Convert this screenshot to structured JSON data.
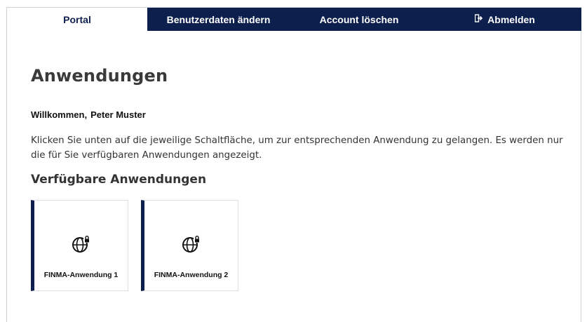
{
  "tabs": [
    {
      "label": "Portal",
      "active": true
    },
    {
      "label": "Benutzerdaten ändern",
      "active": false
    },
    {
      "label": "Account löschen",
      "active": false
    },
    {
      "label": "Abmelden",
      "active": false,
      "icon": "logout-icon"
    }
  ],
  "page": {
    "title": "Anwendungen",
    "welcome_label": "Willkommen,",
    "user_name": "Peter Muster",
    "intro": "Klicken Sie unten auf die jeweilige Schaltfläche, um zur entsprechenden Anwendung zu gelangen. Es werden nur die für Sie verfügbaren Anwendungen angezeigt.",
    "section_title": "Verfügbare Anwendungen"
  },
  "apps": [
    {
      "label": "FINMA-Anwendung 1",
      "icon": "globe-lock-icon"
    },
    {
      "label": "FINMA-Anwendung 2",
      "icon": "globe-lock-icon"
    }
  ],
  "colors": {
    "accent": "#0d1f4c",
    "border": "#dcdfe4"
  }
}
